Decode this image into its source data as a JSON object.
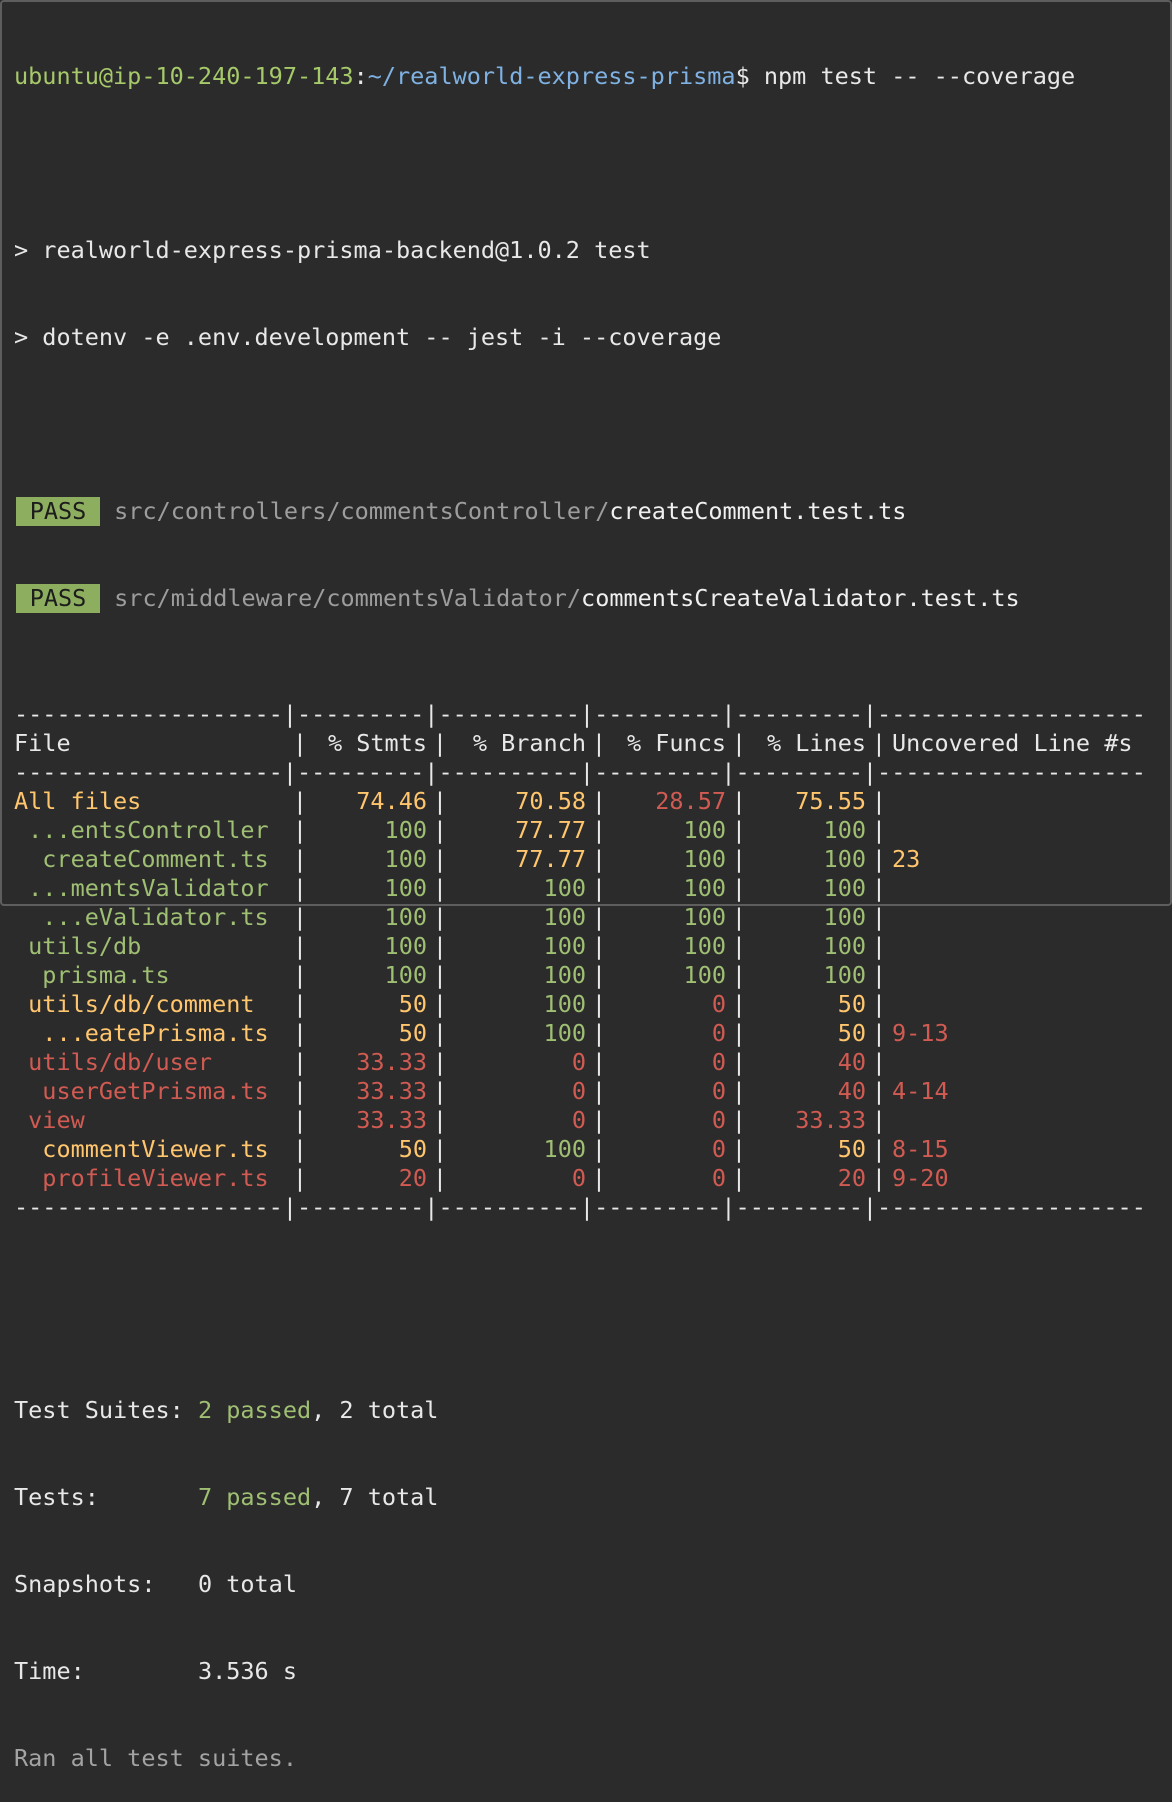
{
  "prompt": {
    "user_host": "ubuntu@ip-10-240-197-143",
    "colon": ":",
    "path": "~/realworld-express-prisma",
    "dollar": "$",
    "command": " npm test -- --coverage"
  },
  "script_lines": [
    "> realworld-express-prisma-backend@1.0.2 test",
    "> dotenv -e .env.development -- jest -i --coverage"
  ],
  "pass_results": [
    {
      "badge": "PASS",
      "dir": "src/controllers/commentsController/",
      "file": "createComment.test.ts"
    },
    {
      "badge": "PASS",
      "dir": "src/middleware/commentsValidator/",
      "file": "commentsCreateValidator.test.ts"
    }
  ],
  "coverage_table": {
    "divider": "-------------------|---------|----------|---------|---------|-------------------",
    "headers": {
      "file": "File",
      "stmts": "% Stmts",
      "branch": "% Branch",
      "funcs": "% Funcs",
      "lines": "% Lines",
      "uncovered": "Uncovered Line #s"
    },
    "separator": "|",
    "rows": [
      {
        "file": "All files",
        "stmts": "74.46",
        "branch": "70.58",
        "funcs": "28.57",
        "lines": "75.55",
        "uncovered": "",
        "colors": {
          "file": "yellow",
          "stmts": "yellow",
          "branch": "yellow",
          "funcs": "red",
          "lines": "yellow",
          "uncovered": "yellow"
        }
      },
      {
        "file": " ...entsController",
        "stmts": "100",
        "branch": "77.77",
        "funcs": "100",
        "lines": "100",
        "uncovered": "",
        "colors": {
          "file": "green",
          "stmts": "green",
          "branch": "yellow",
          "funcs": "green",
          "lines": "green",
          "uncovered": "green"
        }
      },
      {
        "file": "  createComment.ts",
        "stmts": "100",
        "branch": "77.77",
        "funcs": "100",
        "lines": "100",
        "uncovered": "23",
        "colors": {
          "file": "green",
          "stmts": "green",
          "branch": "yellow",
          "funcs": "green",
          "lines": "green",
          "uncovered": "yellow"
        }
      },
      {
        "file": " ...mentsValidator",
        "stmts": "100",
        "branch": "100",
        "funcs": "100",
        "lines": "100",
        "uncovered": "",
        "colors": {
          "file": "green",
          "stmts": "green",
          "branch": "green",
          "funcs": "green",
          "lines": "green",
          "uncovered": "green"
        }
      },
      {
        "file": "  ...eValidator.ts",
        "stmts": "100",
        "branch": "100",
        "funcs": "100",
        "lines": "100",
        "uncovered": "",
        "colors": {
          "file": "green",
          "stmts": "green",
          "branch": "green",
          "funcs": "green",
          "lines": "green",
          "uncovered": "green"
        }
      },
      {
        "file": " utils/db",
        "stmts": "100",
        "branch": "100",
        "funcs": "100",
        "lines": "100",
        "uncovered": "",
        "colors": {
          "file": "green",
          "stmts": "green",
          "branch": "green",
          "funcs": "green",
          "lines": "green",
          "uncovered": "green"
        }
      },
      {
        "file": "  prisma.ts",
        "stmts": "100",
        "branch": "100",
        "funcs": "100",
        "lines": "100",
        "uncovered": "",
        "colors": {
          "file": "green",
          "stmts": "green",
          "branch": "green",
          "funcs": "green",
          "lines": "green",
          "uncovered": "green"
        }
      },
      {
        "file": " utils/db/comment",
        "stmts": "50",
        "branch": "100",
        "funcs": "0",
        "lines": "50",
        "uncovered": "",
        "colors": {
          "file": "yellow",
          "stmts": "yellow",
          "branch": "green",
          "funcs": "red",
          "lines": "yellow",
          "uncovered": "yellow"
        }
      },
      {
        "file": "  ...eatePrisma.ts",
        "stmts": "50",
        "branch": "100",
        "funcs": "0",
        "lines": "50",
        "uncovered": "9-13",
        "colors": {
          "file": "yellow",
          "stmts": "yellow",
          "branch": "green",
          "funcs": "red",
          "lines": "yellow",
          "uncovered": "red"
        }
      },
      {
        "file": " utils/db/user",
        "stmts": "33.33",
        "branch": "0",
        "funcs": "0",
        "lines": "40",
        "uncovered": "",
        "colors": {
          "file": "red",
          "stmts": "red",
          "branch": "red",
          "funcs": "red",
          "lines": "red",
          "uncovered": "red"
        }
      },
      {
        "file": "  userGetPrisma.ts",
        "stmts": "33.33",
        "branch": "0",
        "funcs": "0",
        "lines": "40",
        "uncovered": "4-14",
        "colors": {
          "file": "red",
          "stmts": "red",
          "branch": "red",
          "funcs": "red",
          "lines": "red",
          "uncovered": "red"
        }
      },
      {
        "file": " view",
        "stmts": "33.33",
        "branch": "0",
        "funcs": "0",
        "lines": "33.33",
        "uncovered": "",
        "colors": {
          "file": "red",
          "stmts": "red",
          "branch": "red",
          "funcs": "red",
          "lines": "red",
          "uncovered": "red"
        }
      },
      {
        "file": "  commentViewer.ts",
        "stmts": "50",
        "branch": "100",
        "funcs": "0",
        "lines": "50",
        "uncovered": "8-15",
        "colors": {
          "file": "yellow",
          "stmts": "yellow",
          "branch": "green",
          "funcs": "red",
          "lines": "yellow",
          "uncovered": "red"
        }
      },
      {
        "file": "  profileViewer.ts",
        "stmts": "20",
        "branch": "0",
        "funcs": "0",
        "lines": "20",
        "uncovered": "9-20",
        "colors": {
          "file": "red",
          "stmts": "red",
          "branch": "red",
          "funcs": "red",
          "lines": "red",
          "uncovered": "red"
        }
      }
    ]
  },
  "summary": {
    "suites_label": "Test Suites: ",
    "suites_passed": "2 passed",
    "suites_total": ", 2 total",
    "tests_label": "Tests:       ",
    "tests_passed": "7 passed",
    "tests_total": ", 7 total",
    "snapshots_label": "Snapshots:   ",
    "snapshots_value": "0 total",
    "time_label": "Time:        ",
    "time_value": "3.536 s",
    "ran_all": "Ran all test suites."
  },
  "colors": {
    "background": "#2b2b2b",
    "green": "#9fbf73",
    "yellow": "#ffc66d",
    "red": "#d15b52",
    "pass_badge": "#8eae5f",
    "prompt_path": "#7fb2e3"
  }
}
